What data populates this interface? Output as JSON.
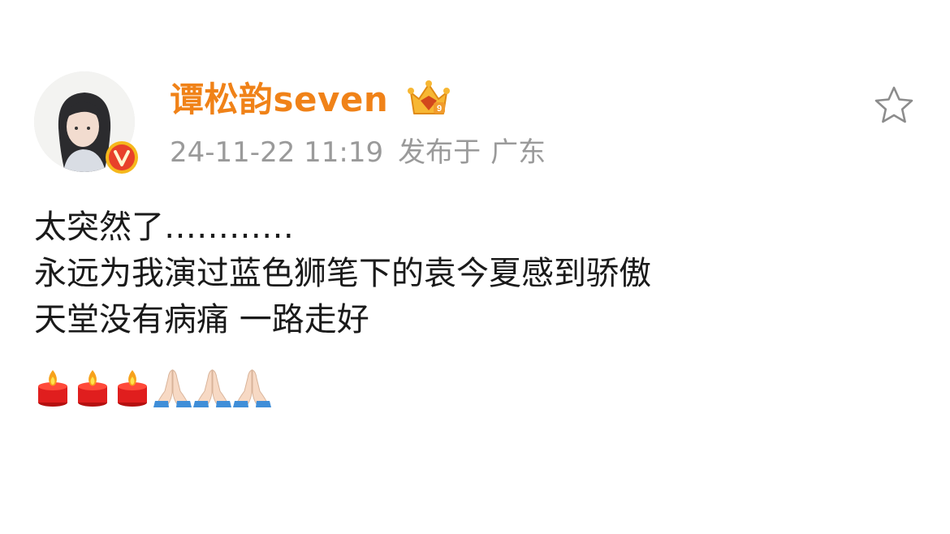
{
  "post": {
    "author": {
      "name": "谭松韵seven",
      "avatar_icon": "avatar-image",
      "verified_badge_icon": "verified-v-icon",
      "member_badge_icon": "vip-crown-icon"
    },
    "meta": {
      "timestamp": "24-11-22 11:19",
      "published_label": "发布于",
      "location": "广东"
    },
    "favorite_icon": "star-outline-icon",
    "lines": [
      "太突然了…………",
      "永远为我演过蓝色狮笔下的袁今夏感到骄傲",
      "天堂没有病痛 一路走好"
    ],
    "emojis": [
      "candle",
      "candle",
      "candle",
      "folded-hands",
      "folded-hands",
      "folded-hands"
    ]
  },
  "colors": {
    "username": "#f08218",
    "meta": "#9a9a9a",
    "verified_badge": "#e8412a",
    "verified_badge_ring": "#f5b81c"
  }
}
